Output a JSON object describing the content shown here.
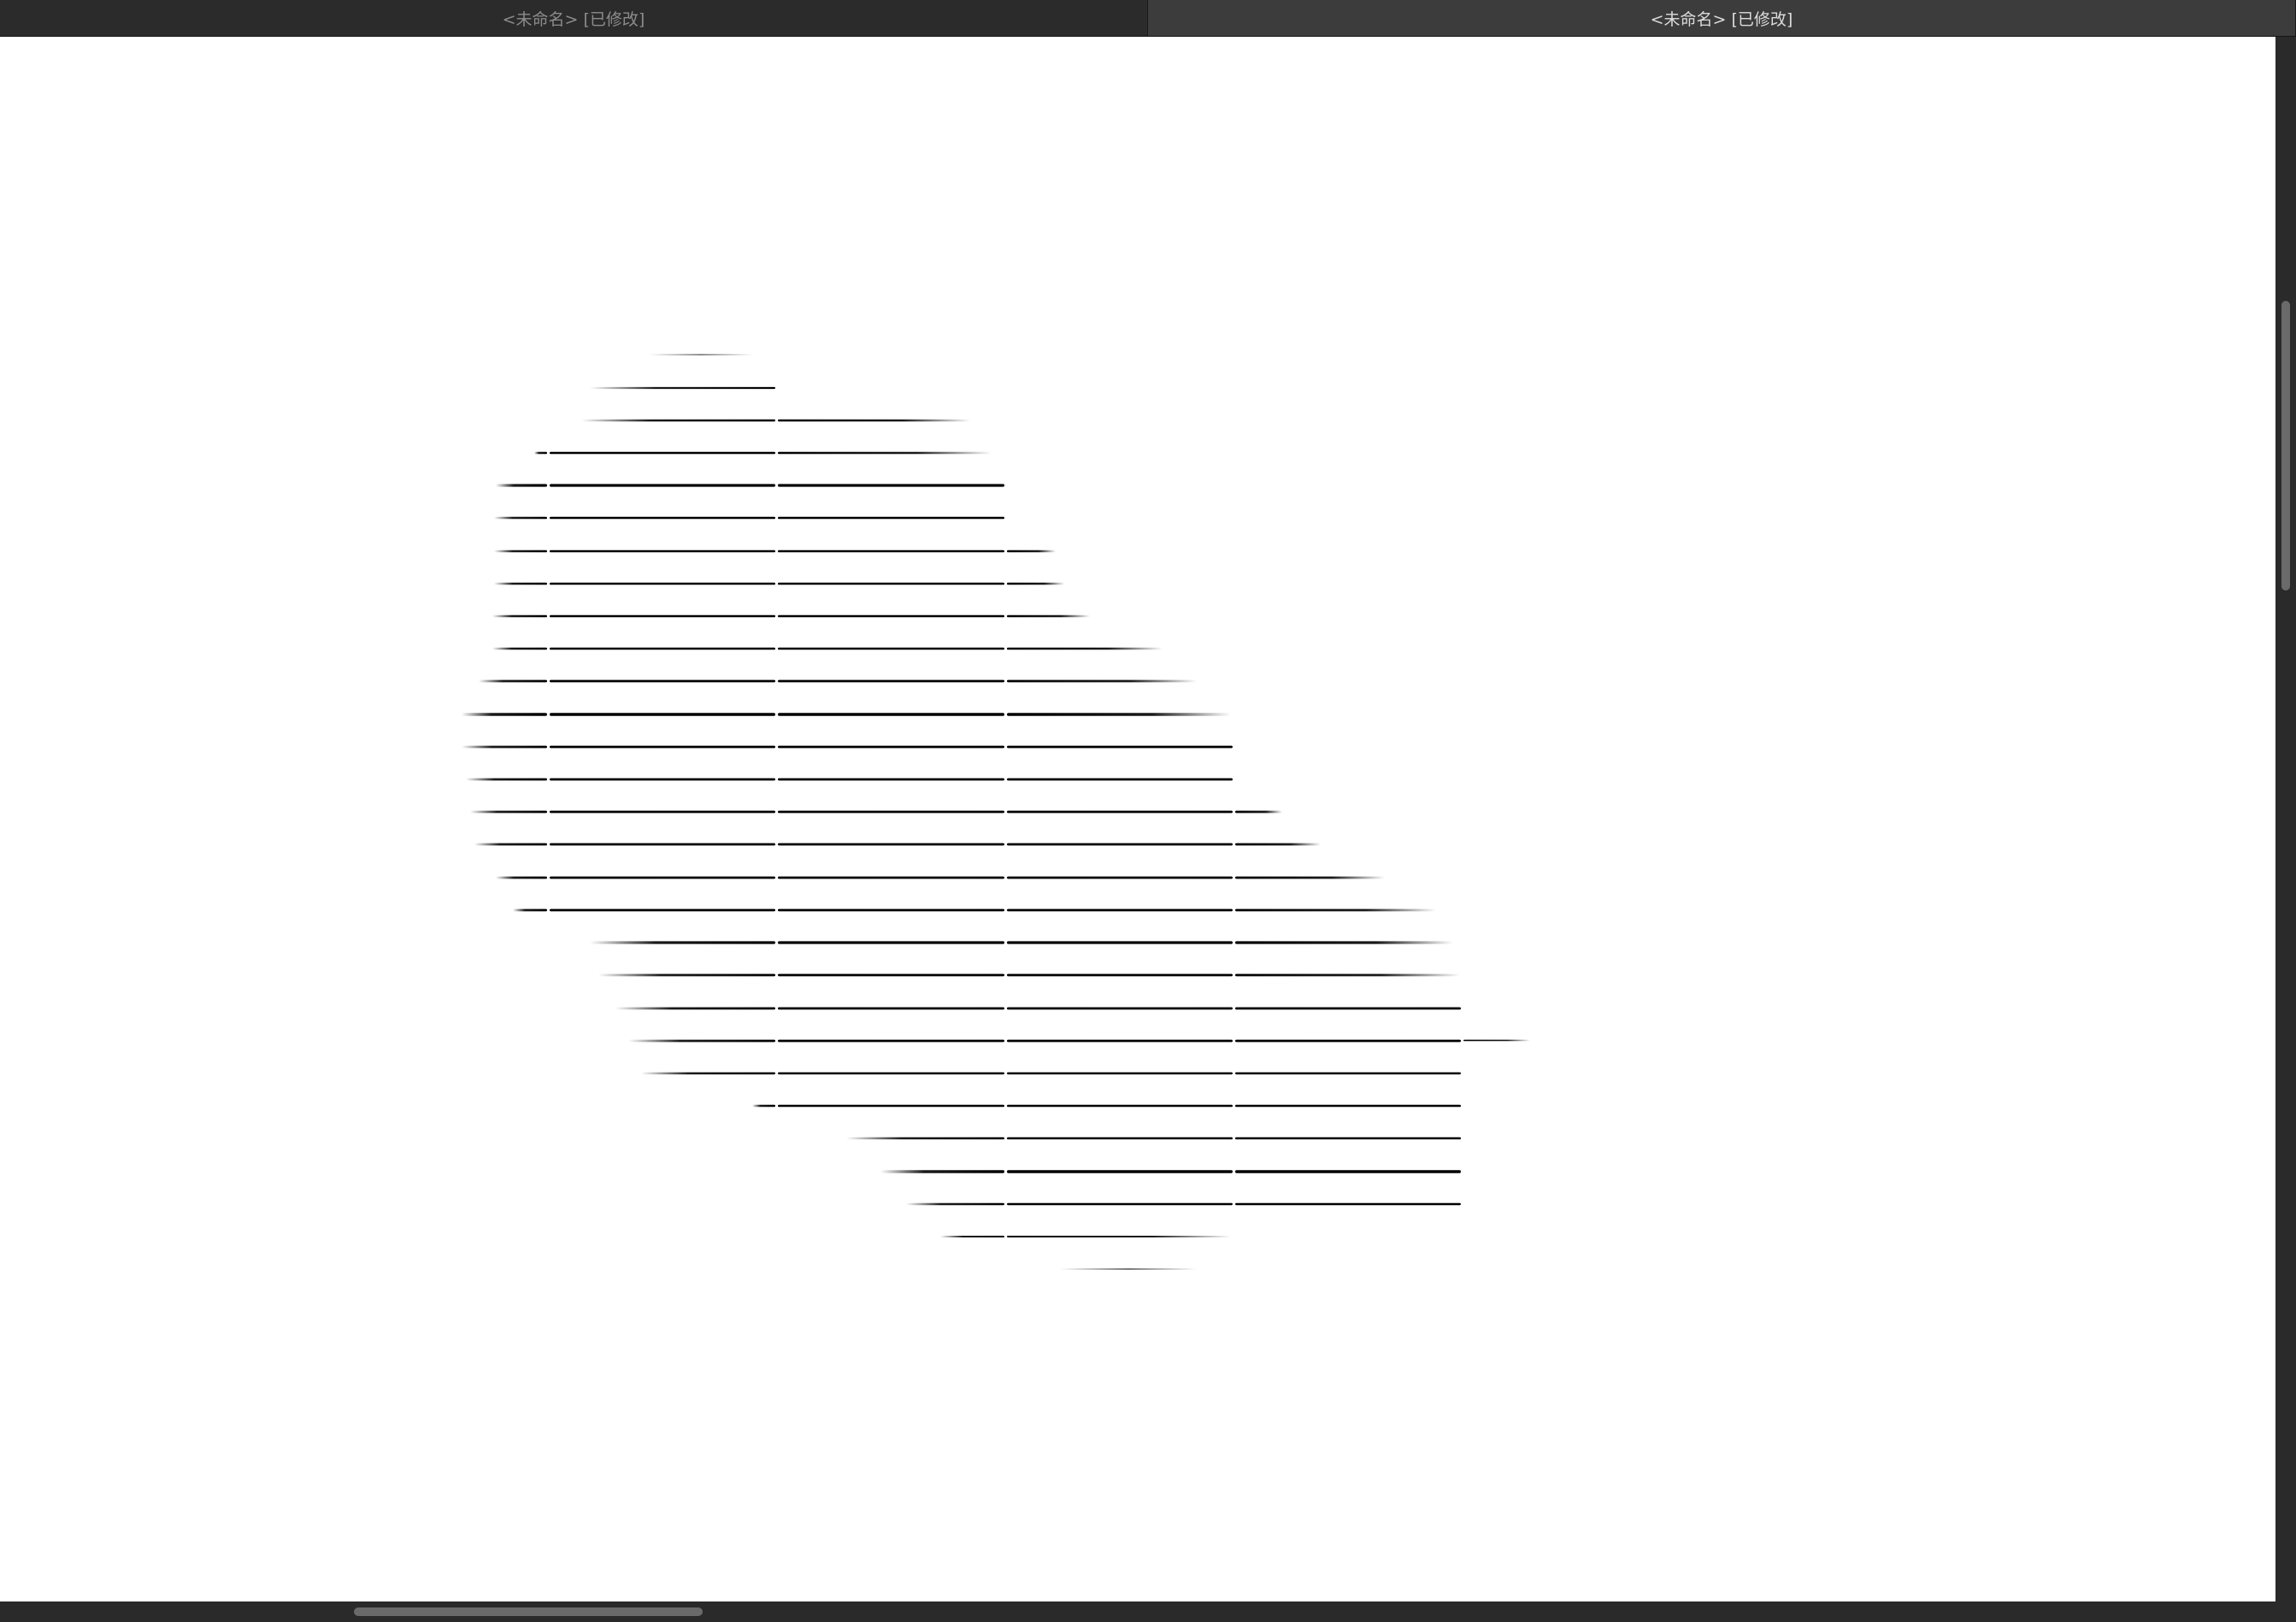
{
  "tabs": [
    {
      "label": "<未命名> [已修改]",
      "active": false
    },
    {
      "label": "<未命名> [已修改]",
      "active": true
    }
  ],
  "scrollbars": {
    "vertical": {
      "thumb_start": 0.169,
      "thumb_end": 0.354
    },
    "horizontal": {
      "thumb_start": 0.154,
      "thumb_end": 0.306
    }
  },
  "colors": {
    "stroke": "#000000",
    "canvas": "#ffffff"
  }
}
